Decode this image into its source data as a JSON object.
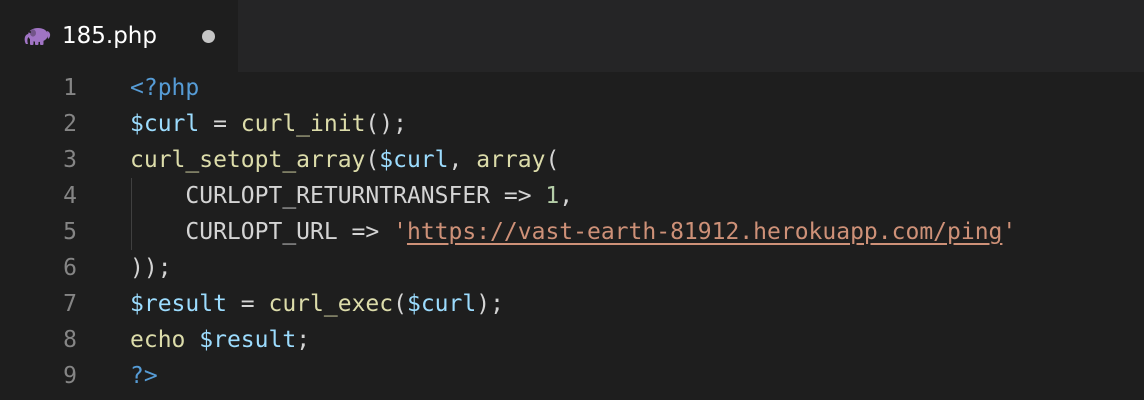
{
  "tab": {
    "filename": "185.php",
    "icon": "php-elephant-icon",
    "icon_color": "#a074c4",
    "modified": true
  },
  "colors": {
    "background": "#1e1e1e",
    "line_number": "#858585",
    "tag": "#569cd6",
    "variable": "#9cdcfe",
    "function": "#dcdcaa",
    "number": "#b5cea8",
    "string": "#ce9178"
  },
  "editor": {
    "lines": [
      {
        "number": "1",
        "tokens": [
          {
            "t": "<?php",
            "c": "tag"
          }
        ]
      },
      {
        "number": "2",
        "tokens": [
          {
            "t": "$curl",
            "c": "var"
          },
          {
            "t": " = ",
            "c": "op"
          },
          {
            "t": "curl_init",
            "c": "fn"
          },
          {
            "t": "();",
            "c": "op"
          }
        ]
      },
      {
        "number": "3",
        "tokens": [
          {
            "t": "curl_setopt_array",
            "c": "fn"
          },
          {
            "t": "(",
            "c": "op"
          },
          {
            "t": "$curl",
            "c": "var"
          },
          {
            "t": ", ",
            "c": "op"
          },
          {
            "t": "array",
            "c": "fn"
          },
          {
            "t": "(",
            "c": "op"
          }
        ]
      },
      {
        "number": "4",
        "guide": true,
        "tokens": [
          {
            "t": "    CURLOPT_RETURNTRANSFER => ",
            "c": "op"
          },
          {
            "t": "1",
            "c": "num"
          },
          {
            "t": ",",
            "c": "op"
          }
        ]
      },
      {
        "number": "5",
        "guide": true,
        "tokens": [
          {
            "t": "    CURLOPT_URL => ",
            "c": "op"
          },
          {
            "t": "'",
            "c": "str"
          },
          {
            "t": "https://vast-earth-81912.herokuapp.com/ping",
            "c": "str",
            "link": true
          },
          {
            "t": "'",
            "c": "str"
          }
        ]
      },
      {
        "number": "6",
        "tokens": [
          {
            "t": "));",
            "c": "op"
          }
        ]
      },
      {
        "number": "7",
        "tokens": [
          {
            "t": "$result",
            "c": "var"
          },
          {
            "t": " = ",
            "c": "op"
          },
          {
            "t": "curl_exec",
            "c": "fn"
          },
          {
            "t": "(",
            "c": "op"
          },
          {
            "t": "$curl",
            "c": "var"
          },
          {
            "t": ");",
            "c": "op"
          }
        ]
      },
      {
        "number": "8",
        "tokens": [
          {
            "t": "echo",
            "c": "fn"
          },
          {
            "t": " ",
            "c": "op"
          },
          {
            "t": "$result",
            "c": "var"
          },
          {
            "t": ";",
            "c": "op"
          }
        ]
      },
      {
        "number": "9",
        "tokens": [
          {
            "t": "?>",
            "c": "tag"
          }
        ]
      }
    ]
  }
}
